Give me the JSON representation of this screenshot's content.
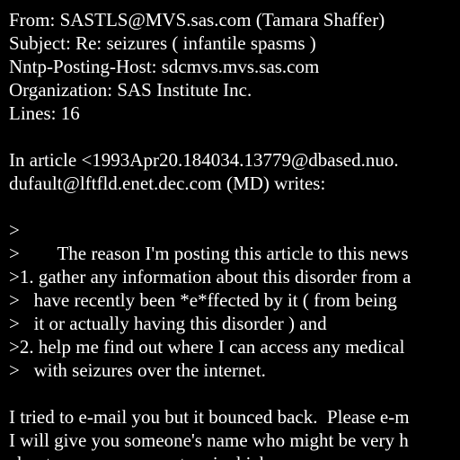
{
  "colors": {
    "background": "#000000",
    "text": "#ffffff"
  },
  "message": {
    "lines": [
      "From: SASTLS@MVS.sas.com (Tamara Shaffer)",
      "Subject: Re: seizures ( infantile spasms )",
      "Nntp-Posting-Host: sdcmvs.mvs.sas.com",
      "Organization: SAS Institute Inc.",
      "Lines: 16",
      "",
      "In article <1993Apr20.184034.13779@dbased.nuo.",
      "dufault@lftfld.enet.dec.com (MD) writes:",
      "",
      ">",
      ">        The reason I'm posting this article to this news",
      ">1. gather any information about this disorder from a",
      ">   have recently been *e*ffected by it ( from being ",
      ">   it or actually having this disorder ) and",
      ">2. help me find out where I can access any medical",
      ">   with seizures over the internet.",
      "",
      "I tried to e-mail you but it bounced back.  Please e-m",
      "I will give you someone's name who might be very h",
      "about your concerns, at ami which"
    ]
  }
}
